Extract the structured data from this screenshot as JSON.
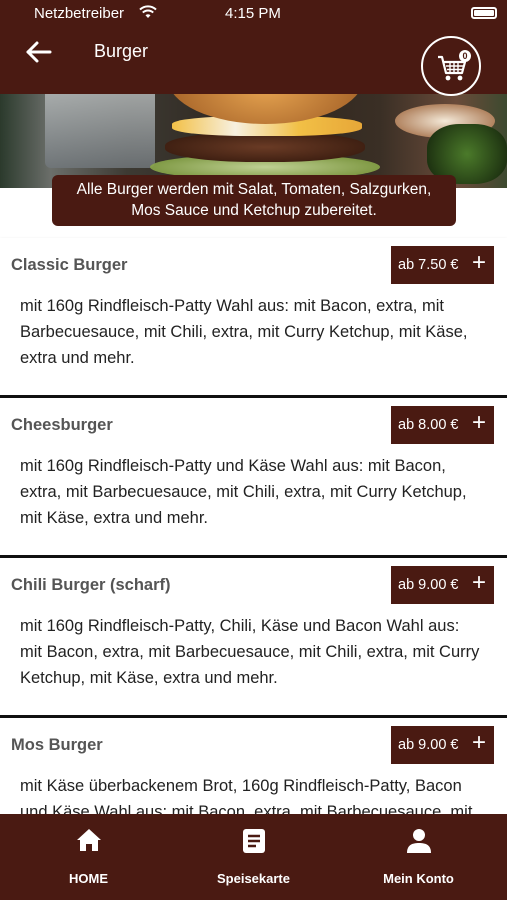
{
  "status_bar": {
    "carrier": "Netzbetreiber",
    "time": "4:15 PM"
  },
  "header": {
    "title": "Burger",
    "cart_count": "0"
  },
  "notice": {
    "line1": "Alle Burger werden mit Salat, Tomaten, Salzgurken,",
    "line2": "Mos Sauce und Ketchup zubereitet."
  },
  "items": [
    {
      "name": "Classic Burger",
      "price": "ab 7.50 €",
      "description": "mit 160g Rindfleisch-Patty Wahl aus: mit Bacon, extra, mit Barbecuesauce, mit Chili, extra, mit Curry Ketchup, mit Käse, extra und mehr."
    },
    {
      "name": "Cheesburger",
      "price": "ab 8.00 €",
      "description": "mit 160g Rindfleisch-Patty und Käse Wahl aus: mit Bacon, extra, mit Barbecuesauce, mit Chili, extra, mit Curry Ketchup, mit Käse, extra und mehr."
    },
    {
      "name": "Chili Burger (scharf)",
      "price": "ab 9.00 €",
      "description": "mit 160g Rindfleisch-Patty, Chili, Käse und Bacon Wahl aus: mit Bacon, extra, mit Barbecuesauce, mit Chili, extra, mit Curry Ketchup, mit Käse, extra und mehr."
    },
    {
      "name": "Mos Burger",
      "price": "ab 9.00 €",
      "description": "mit Käse überbackenem Brot, 160g Rindfleisch-Patty, Bacon und Käse Wahl aus: mit Bacon, extra, mit Barbecuesauce, mit"
    }
  ],
  "bottom_nav": {
    "home": "HOME",
    "menu": "Speisekarte",
    "account": "Mein Konto"
  },
  "colors": {
    "brand": "#4a1a12"
  },
  "icons": {
    "back": "arrow-left-icon",
    "cart": "cart-icon",
    "home": "home-icon",
    "menu": "menu-card-icon",
    "account": "user-icon"
  }
}
